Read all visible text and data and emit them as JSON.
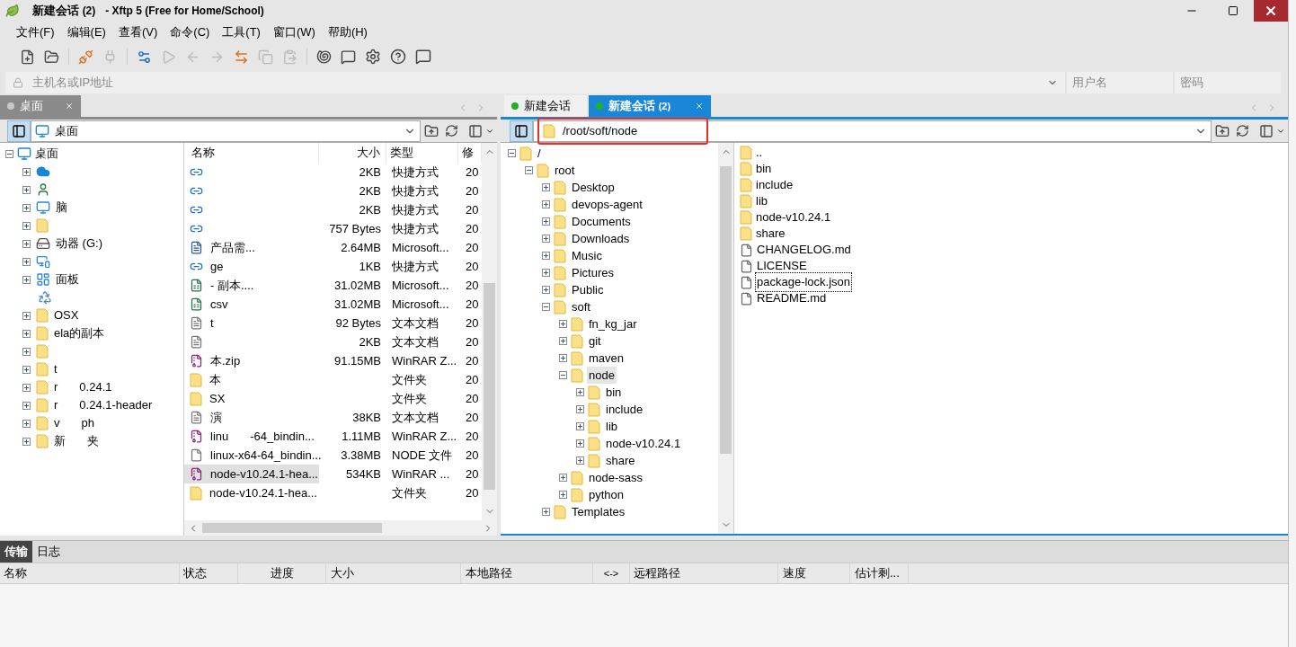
{
  "window": {
    "title": "新建会话",
    "title_count": "(2)",
    "title_rest": "- Xftp 5 (Free for Home/School)"
  },
  "menu": [
    "文件(F)",
    "编辑(E)",
    "查看(V)",
    "命令(C)",
    "工具(T)",
    "窗口(W)",
    "帮助(H)"
  ],
  "address": {
    "placeholder": "主机名或IP地址",
    "user_placeholder": "用户名",
    "password_placeholder": "密码"
  },
  "left": {
    "tab": {
      "label": "桌面",
      "selected": false
    },
    "path": "桌面",
    "tree": {
      "label": "桌面",
      "kind": "desktop",
      "expanded": true,
      "children": [
        {
          "kind": "cloud",
          "expanded": false
        },
        {
          "kind": "user",
          "expanded": false
        },
        {
          "kind": "computer",
          "expanded": false,
          "parts": [
            "脑"
          ]
        },
        {
          "kind": "folder",
          "expanded": false
        },
        {
          "kind": "drive",
          "expanded": false,
          "parts": [
            "动器 (G:)"
          ]
        },
        {
          "kind": "network",
          "expanded": false
        },
        {
          "kind": "control",
          "expanded": false,
          "parts": [
            "面板"
          ]
        },
        {
          "kind": "recycle"
        },
        {
          "kind": "folder",
          "expanded": false,
          "parts": [
            "OSX"
          ]
        },
        {
          "kind": "folder",
          "expanded": false,
          "parts": [
            "ela的副本"
          ]
        },
        {
          "kind": "folder",
          "expanded": false
        },
        {
          "kind": "folder",
          "expanded": false,
          "parts": [
            "t"
          ]
        },
        {
          "kind": "folder",
          "expanded": false,
          "parts": [
            "r",
            "0.24.1"
          ]
        },
        {
          "kind": "folder",
          "expanded": false,
          "parts": [
            "r",
            "0.24.1-header"
          ]
        },
        {
          "kind": "folder",
          "expanded": false,
          "parts": [
            "v",
            "ph"
          ]
        },
        {
          "kind": "folder",
          "expanded": false,
          "parts": [
            "新",
            "夹"
          ]
        }
      ]
    },
    "columns": [
      "名称",
      "大小",
      "类型",
      "修"
    ],
    "files": [
      {
        "kind": "shortcut",
        "size": "2KB",
        "type": "快捷方式",
        "date": "20",
        "selected": false
      },
      {
        "kind": "shortcut",
        "size": "2KB",
        "type": "快捷方式",
        "date": "20",
        "selected": false
      },
      {
        "kind": "shortcut",
        "size": "2KB",
        "type": "快捷方式",
        "date": "20",
        "selected": false
      },
      {
        "kind": "shortcut",
        "size": "757 Bytes",
        "type": "快捷方式",
        "date": "20",
        "selected": false
      },
      {
        "kind": "word",
        "parts": [
          "产品需..."
        ],
        "size": "2.64MB",
        "type": "Microsoft...",
        "date": "20",
        "selected": false
      },
      {
        "kind": "shortcut",
        "parts": [
          "ge"
        ],
        "size": "1KB",
        "type": "快捷方式",
        "date": "20",
        "selected": false
      },
      {
        "kind": "excel",
        "parts": [
          "- 副本...."
        ],
        "size": "31.02MB",
        "type": "Microsoft...",
        "date": "20",
        "selected": false
      },
      {
        "kind": "excel",
        "parts": [
          "csv"
        ],
        "size": "31.02MB",
        "type": "Microsoft...",
        "date": "20",
        "selected": false
      },
      {
        "kind": "text",
        "parts": [
          "t"
        ],
        "size": "92 Bytes",
        "type": "文本文档",
        "date": "20",
        "selected": false
      },
      {
        "kind": "text",
        "size": "2KB",
        "type": "文本文档",
        "date": "20",
        "selected": false
      },
      {
        "kind": "archive",
        "parts": [
          "本.zip"
        ],
        "size": "91.15MB",
        "type": "WinRAR Z...",
        "date": "20",
        "selected": false
      },
      {
        "kind": "folder",
        "parts": [
          "本"
        ],
        "type": "文件夹",
        "date": "20",
        "selected": false
      },
      {
        "kind": "folder",
        "parts": [
          "SX"
        ],
        "type": "文件夹",
        "date": "20",
        "selected": false
      },
      {
        "kind": "text",
        "parts": [
          "演"
        ],
        "size": "38KB",
        "type": "文本文档",
        "date": "20",
        "selected": false
      },
      {
        "kind": "archive",
        "parts": [
          "linu",
          "-64_bindin..."
        ],
        "size": "1.11MB",
        "type": "WinRAR Z...",
        "date": "20",
        "selected": false
      },
      {
        "kind": "file",
        "parts": [
          "linux-x64-64_bindin..."
        ],
        "size": "3.38MB",
        "type": "NODE 文件",
        "date": "20",
        "selected": false
      },
      {
        "kind": "archive",
        "parts": [
          "node-v10.24.1-hea..."
        ],
        "size": "534KB",
        "type": "WinRAR ...",
        "date": "20",
        "selected": true
      },
      {
        "kind": "folder",
        "parts": [
          "node-v10.24.1-hea..."
        ],
        "type": "文件夹",
        "date": "20",
        "selected": false
      }
    ]
  },
  "right": {
    "tabs": [
      {
        "label": "新建会话",
        "selected": false
      },
      {
        "label": "新建会话",
        "count": "(2)",
        "selected": true
      }
    ],
    "path": "/root/soft/node",
    "highlighted": true,
    "tree": {
      "label": "/",
      "expanded": true,
      "selected": false,
      "children": [
        {
          "label": "root",
          "expanded": true,
          "selected": false,
          "children": [
            {
              "label": "Desktop",
              "expanded": false,
              "selected": false
            },
            {
              "label": "devops-agent",
              "expanded": false,
              "selected": false
            },
            {
              "label": "Documents",
              "expanded": false,
              "selected": false
            },
            {
              "label": "Downloads",
              "expanded": false,
              "selected": false
            },
            {
              "label": "Music",
              "expanded": false,
              "selected": false
            },
            {
              "label": "Pictures",
              "expanded": false,
              "selected": false
            },
            {
              "label": "Public",
              "expanded": false,
              "selected": false
            },
            {
              "label": "soft",
              "expanded": true,
              "selected": false,
              "children": [
                {
                  "label": "fn_kg_jar",
                  "expanded": false,
                  "selected": false
                },
                {
                  "label": "git",
                  "expanded": false,
                  "selected": false
                },
                {
                  "label": "maven",
                  "expanded": false,
                  "selected": false
                },
                {
                  "label": "node",
                  "expanded": true,
                  "selected": true,
                  "children": [
                    {
                      "label": "bin",
                      "expanded": false,
                      "selected": false
                    },
                    {
                      "label": "include",
                      "expanded": false,
                      "selected": false
                    },
                    {
                      "label": "lib",
                      "expanded": false,
                      "selected": false
                    },
                    {
                      "label": "node-v10.24.1",
                      "expanded": false,
                      "selected": false
                    },
                    {
                      "label": "share",
                      "expanded": false,
                      "selected": false
                    }
                  ]
                },
                {
                  "label": "node-sass",
                  "expanded": false,
                  "selected": false
                },
                {
                  "label": "python",
                  "expanded": false,
                  "selected": false
                }
              ]
            },
            {
              "label": "Templates",
              "expanded": false,
              "selected": false
            }
          ]
        }
      ]
    },
    "files": [
      {
        "kind": "folder",
        "name": "..",
        "focused": false
      },
      {
        "kind": "folder",
        "name": "bin",
        "focused": false
      },
      {
        "kind": "folder",
        "name": "include",
        "focused": false
      },
      {
        "kind": "folder",
        "name": "lib",
        "focused": false
      },
      {
        "kind": "folder",
        "name": "node-v10.24.1",
        "focused": false
      },
      {
        "kind": "folder",
        "name": "share",
        "focused": false
      },
      {
        "kind": "file",
        "name": "CHANGELOG.md",
        "focused": false
      },
      {
        "kind": "file",
        "name": "LICENSE",
        "focused": false
      },
      {
        "kind": "file",
        "name": "package-lock.json",
        "focused": true
      },
      {
        "kind": "file",
        "name": "README.md",
        "focused": false
      }
    ]
  },
  "transfer": {
    "tabs": [
      {
        "label": "传输",
        "selected": true
      },
      {
        "label": "日志",
        "selected": false
      }
    ],
    "columns": [
      "名称",
      "状态",
      "进度",
      "大小",
      "本地路径",
      "<->",
      "远程路径",
      "速度",
      "估计剩..."
    ]
  }
}
